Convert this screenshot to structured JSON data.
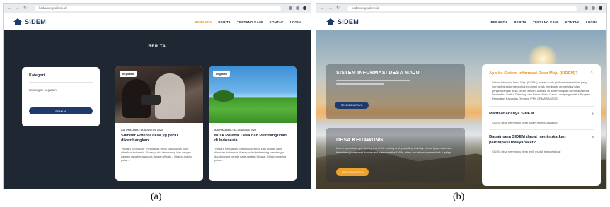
{
  "panel_a": {
    "url": "kedawung.sidem.id",
    "brand": "SIDEM",
    "menu": [
      "BERANDA",
      "BERITA",
      "TENTANG KAMI",
      "KONTAK",
      "LOGIN"
    ],
    "page_title": "BERITA",
    "category": {
      "title": "Kategori",
      "item": "Keuangan kegiatan",
      "button": "SEMUA"
    },
    "cards": [
      {
        "tag": "kegiatan",
        "meta": "ADI PRATAMA | 14 AGUSTUS 2023",
        "title": "Sumber Potensi desa yg perlu dikembangkan",
        "excerpt": "\"Negara Kepulauan\" merupakan sebut satu julukan yang diberikan Indonesia. Alasan pulau berbentang luas dengan daratan yang berada pada daratan Wisata... Masing-masing pulau..."
      },
      {
        "tag": "kegiatan",
        "meta": "ADI PRATAMA | 14 AGUSTUS 2023",
        "title": "Kusk Potensi Desa dan Pembangunan di Indonesia",
        "excerpt": "\"Negara Kepulauan\" merupakan sebut satu julukan yang diberikan Indonesia. Alasan pulau berbentang luas dengan daratan yang berada pada daratan Wisata... Masing-masing pulau..."
      }
    ]
  },
  "panel_b": {
    "url": "kedawung.sidem.id",
    "brand": "SIDEM",
    "menu": [
      "BERANDA",
      "BERITA",
      "TENTANG KAMI",
      "KONTAK",
      "LOGIN"
    ],
    "hero_title": "SISTEM INFORMASI DESA MAJU",
    "hero_button": "SELENGKAPNYA",
    "desa_title": "DESA KEDAWUNG",
    "desa_text": "Lorem ipsum is simply dummy text of the printing and typesetting industry. Lorem Ipsum has been the industry's standard dummy text ever since the 1500s, when an unknown printer took a galley.",
    "desa_button": "SELENGKAPNYA",
    "faq": [
      {
        "question": "Apa itu Sistem Informasi Desa Maju (SIDEM)?",
        "answer": "Sistem Informasi Desa Maju (SIDEM) adalah suatu platform desa sistem yang mengintegrasikan teknologi informasi untuk membantu pengelolaan dan pengembangan desa secara efisien. Aplikasi ini dikembangkan oleh mahasiswa Informatika Institut Teknologi dan Bisnis Widya Gama Lumajang melalui Program Penguatan Kapasitas Ormawa (PPK ORMAWA) 2023.",
        "open": true
      },
      {
        "question": "Manfaat adanya SIDEM",
        "answer": "SIDEM desa membantu desa dalam mempublikasikan",
        "open": false
      },
      {
        "question": "Bagaimana SIDEM dapat meningkatkan partisipasi masyarakat?",
        "answer": "SIDEM desa membantu desa lebih mudah berpartisipasi",
        "open": false
      }
    ]
  },
  "captions": [
    "(a)",
    "(b)"
  ]
}
